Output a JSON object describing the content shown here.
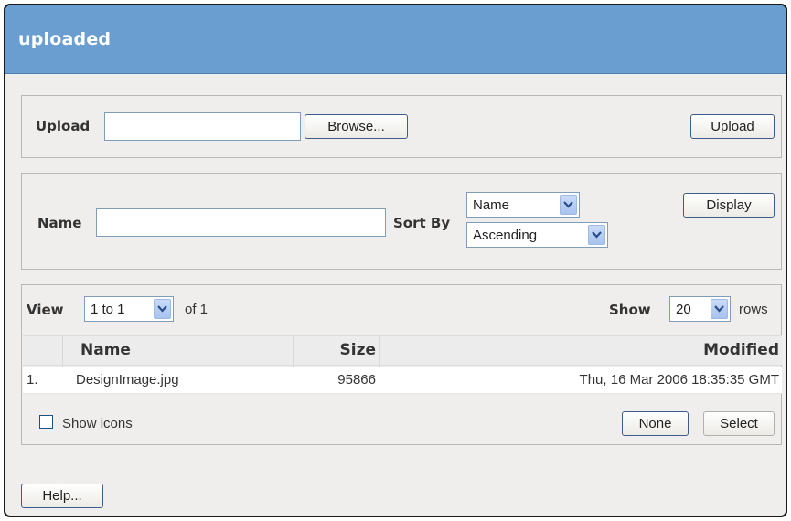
{
  "window": {
    "title": "uploaded"
  },
  "upload": {
    "label": "Upload",
    "file_value": "",
    "browse_label": "Browse...",
    "upload_button": "Upload"
  },
  "filter": {
    "name_label": "Name",
    "name_value": "",
    "sortby_label": "Sort By",
    "sort_field": "Name",
    "sort_order": "Ascending",
    "display_button": "Display"
  },
  "listing": {
    "view_label": "View",
    "view_range": "1 to 1",
    "of_label": "of 1",
    "show_label": "Show",
    "rows_per_page": "20",
    "rows_label": "rows",
    "columns": [
      "Name",
      "Size",
      "Modified"
    ],
    "rows": [
      {
        "index": "1.",
        "name": "DesignImage.jpg",
        "size": "95866",
        "modified": "Thu, 16 Mar 2006 18:35:35 GMT"
      }
    ],
    "show_icons_label": "Show icons",
    "none_button": "None",
    "select_button": "Select"
  },
  "help_button": "Help..."
}
